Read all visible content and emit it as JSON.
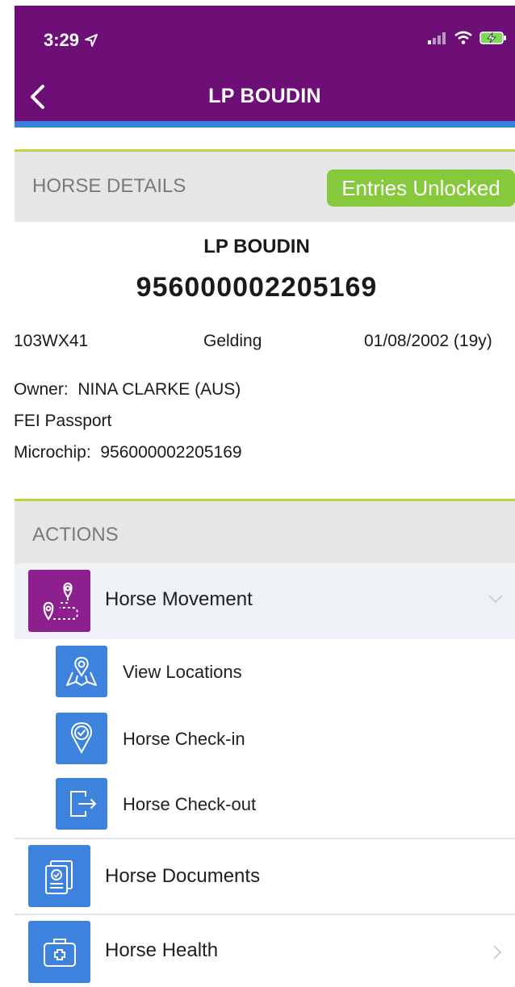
{
  "status_bar": {
    "time": "3:29"
  },
  "header": {
    "title": "LP BOUDIN"
  },
  "horse_details": {
    "section_title": "HORSE DETAILS",
    "entries_badge": "Entries Unlocked",
    "name": "LP BOUDIN",
    "chip_number": "956000002205169",
    "code": "103WX41",
    "sex": "Gelding",
    "birth": "01/08/2002 (19y)",
    "owner_label": "Owner:",
    "owner": "NINA CLARKE (AUS)",
    "passport": "FEI Passport",
    "microchip_label": "Microchip:",
    "microchip": "956000002205169"
  },
  "actions": {
    "section_title": "ACTIONS",
    "items": [
      {
        "label": "Horse Movement",
        "icon": "map-route-icon",
        "expanded": true,
        "subitems": [
          {
            "label": "View Locations",
            "icon": "location-map-icon"
          },
          {
            "label": "Horse Check-in",
            "icon": "check-pin-icon"
          },
          {
            "label": "Horse Check-out",
            "icon": "exit-door-icon"
          }
        ]
      },
      {
        "label": "Horse Documents",
        "icon": "documents-icon"
      },
      {
        "label": "Horse Health",
        "icon": "medical-kit-icon"
      }
    ]
  },
  "colors": {
    "header": "#6e0f78",
    "accent_blue": "#3a7fdc",
    "badge_green": "#86c93c",
    "section_border": "#b7d63a",
    "movement_icon_bg": "#8d1f8f"
  }
}
